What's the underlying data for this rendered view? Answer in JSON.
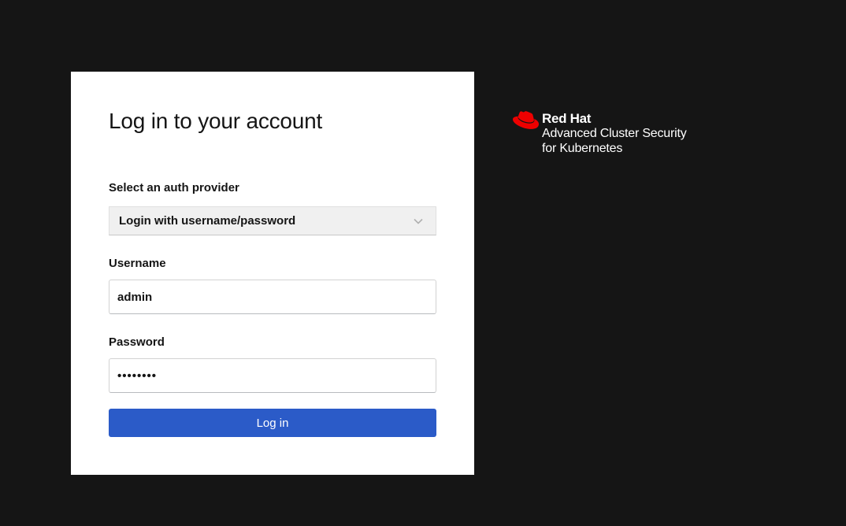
{
  "login": {
    "title": "Log in to your account",
    "auth_provider": {
      "label": "Select an auth provider",
      "selected": "Login with username/password"
    },
    "username": {
      "label": "Username",
      "value": "admin"
    },
    "password": {
      "label": "Password",
      "value": "••••••••"
    },
    "submit_label": "Log in"
  },
  "brand": {
    "company": "Red Hat",
    "product_line1": "Advanced Cluster Security",
    "product_line2": "for Kubernetes",
    "logo_icon": "red-hat-fedora-icon",
    "logo_color": "#ee0000"
  },
  "colors": {
    "background": "#151515",
    "card": "#ffffff",
    "primary_button": "#2b5bc8"
  }
}
